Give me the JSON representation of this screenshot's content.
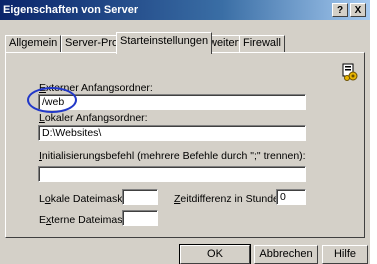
{
  "window": {
    "title": "Eigenschaften von Server",
    "help_label": "?",
    "close_label": "X"
  },
  "tabs": [
    {
      "label": "Allgemein"
    },
    {
      "label": "Server-Profil"
    },
    {
      "label": "Starteinstellungen",
      "active": true
    },
    {
      "label": "Erweitert"
    },
    {
      "label": "Firewall"
    }
  ],
  "form": {
    "external_folder": {
      "label_first": "E",
      "label_rest": "xterner Anfangsordner:",
      "value": "/web"
    },
    "local_folder": {
      "label_first": "L",
      "label_rest": "okaler Anfangsordner:",
      "value": "D:\\Websites\\"
    },
    "init_command": {
      "label_first": "I",
      "label_rest": "nitialisierungsbefehl (mehrere Befehle durch \";\" trennen):",
      "value": ""
    },
    "local_mask": {
      "label_pre": "L",
      "label_ul": "o",
      "label_post": "kale Dateimaske:",
      "value": ""
    },
    "time_diff": {
      "label_pre": "",
      "label_ul": "Z",
      "label_post": "eitdifferenz in Stunden:",
      "value": "0"
    },
    "external_mask": {
      "label_pre": "E",
      "label_ul": "x",
      "label_post": "terne Dateimaske:",
      "value": ""
    }
  },
  "buttons": {
    "ok": "OK",
    "cancel": "Abbrechen",
    "help": "Hilfe"
  },
  "accent": {
    "highlight_oval": "#2238c8",
    "title_bar": "#0a246a"
  },
  "icons": {
    "panel_icon": "server-settings-icon"
  }
}
